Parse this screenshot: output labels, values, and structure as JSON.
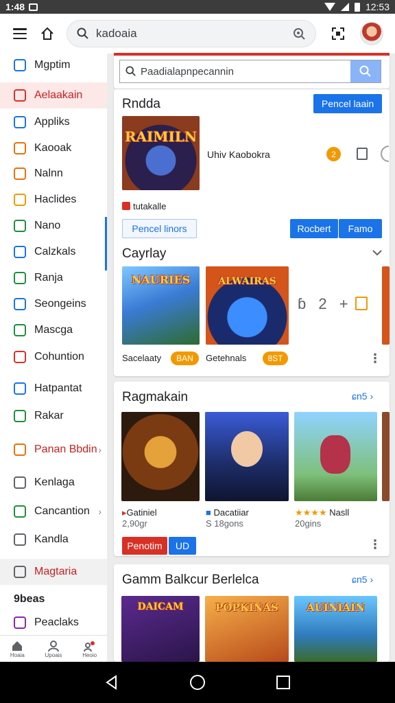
{
  "status_bar": {
    "time_left": "1:48",
    "time_right": "12:53"
  },
  "topbar": {
    "search_text": "kadoaia"
  },
  "sidebar": {
    "items": [
      {
        "label": "Mgptim",
        "icon": "tag-icon",
        "color": "#1a73e8"
      },
      {
        "label": "Aelaakain",
        "icon": "home-icon",
        "color": "#d93025"
      },
      {
        "label": "Appliks",
        "icon": "apps-icon",
        "color": "#1a73e8"
      },
      {
        "label": "Kaooak",
        "icon": "gamepad-icon",
        "color": "#e8710a"
      },
      {
        "label": "Nalnn",
        "icon": "bag-icon",
        "color": "#e8710a"
      },
      {
        "label": "Haclides",
        "icon": "coin-icon",
        "color": "#f29900"
      },
      {
        "label": "Nano",
        "icon": "lock-icon",
        "color": "#1e8e3e"
      },
      {
        "label": "Calzkals",
        "icon": "check-icon",
        "color": "#1a73e8"
      },
      {
        "label": "Ranja",
        "icon": "image-icon",
        "color": "#1e8e3e"
      },
      {
        "label": "Seongeins",
        "icon": "chart-icon",
        "color": "#1a73e8"
      },
      {
        "label": "Mascga",
        "icon": "play-icon",
        "color": "#1e8e3e"
      },
      {
        "label": "Cohuntion",
        "icon": "puzzle-icon",
        "color": "#d93025"
      },
      {
        "label": "Hatpantat",
        "icon": "phone-icon",
        "color": "#1a73e8"
      },
      {
        "label": "Rakar",
        "icon": "leaf-icon",
        "color": "#1e8e3e"
      },
      {
        "label": "Panan Bbdin",
        "icon": "tools-icon",
        "color": "#e8710a"
      },
      {
        "label": "Kenlaga",
        "icon": "link-icon",
        "color": "#5f6368"
      },
      {
        "label": "Cancantion",
        "icon": "refresh-icon",
        "color": "#1e8e3e"
      },
      {
        "label": "Kandla",
        "icon": "book-icon",
        "color": "#5f6368"
      },
      {
        "label": "Magtaria",
        "icon": "home-outline-icon",
        "color": "#5f6368"
      },
      {
        "label": "9beas",
        "icon": "",
        "color": ""
      },
      {
        "label": "Peaclaks",
        "icon": "avatar-icon",
        "color": "#8e24aa"
      }
    ],
    "bottom_tabs": [
      "Hoaia",
      "Upoais",
      "Heoio"
    ]
  },
  "inner_search": {
    "text": "Paadialapnpecannin"
  },
  "featured": {
    "title": "Rndda",
    "action": "Pencel laain",
    "art_text": "RAIMILN",
    "app_name": "Uhiv Kaobokra",
    "badge": "2",
    "source": "tutakalle",
    "btn_outline": "Pencel linors",
    "btn_a": "Rocbert",
    "btn_b": "Famo"
  },
  "carousel": {
    "title": "Cayrlay",
    "items": [
      {
        "name": "Sacelaaty",
        "tag": "BAN",
        "art": "NAURIES"
      },
      {
        "name": "Getehnals",
        "tag": "8ST",
        "art": "ALWAIRAS"
      }
    ],
    "pager_text": "ɓ 2 +"
  },
  "ragmakain": {
    "title": "Ragmakain",
    "more": "ɕn5",
    "items": [
      {
        "name": "Gatiniel",
        "sub": "2,90gr"
      },
      {
        "name": "Dacatiiar",
        "sub": "S 18gons"
      },
      {
        "name": "Nasll",
        "sub": "20gins"
      }
    ],
    "btn_red": "Penotim",
    "btn_blue": "UD"
  },
  "gamen": {
    "title": "Gamm Balkcur Berlelca",
    "more": "ɕn5",
    "items": [
      {
        "art": "DAICAM"
      },
      {
        "art": "POPKINAS"
      },
      {
        "art": "AUINIAIN"
      }
    ]
  }
}
